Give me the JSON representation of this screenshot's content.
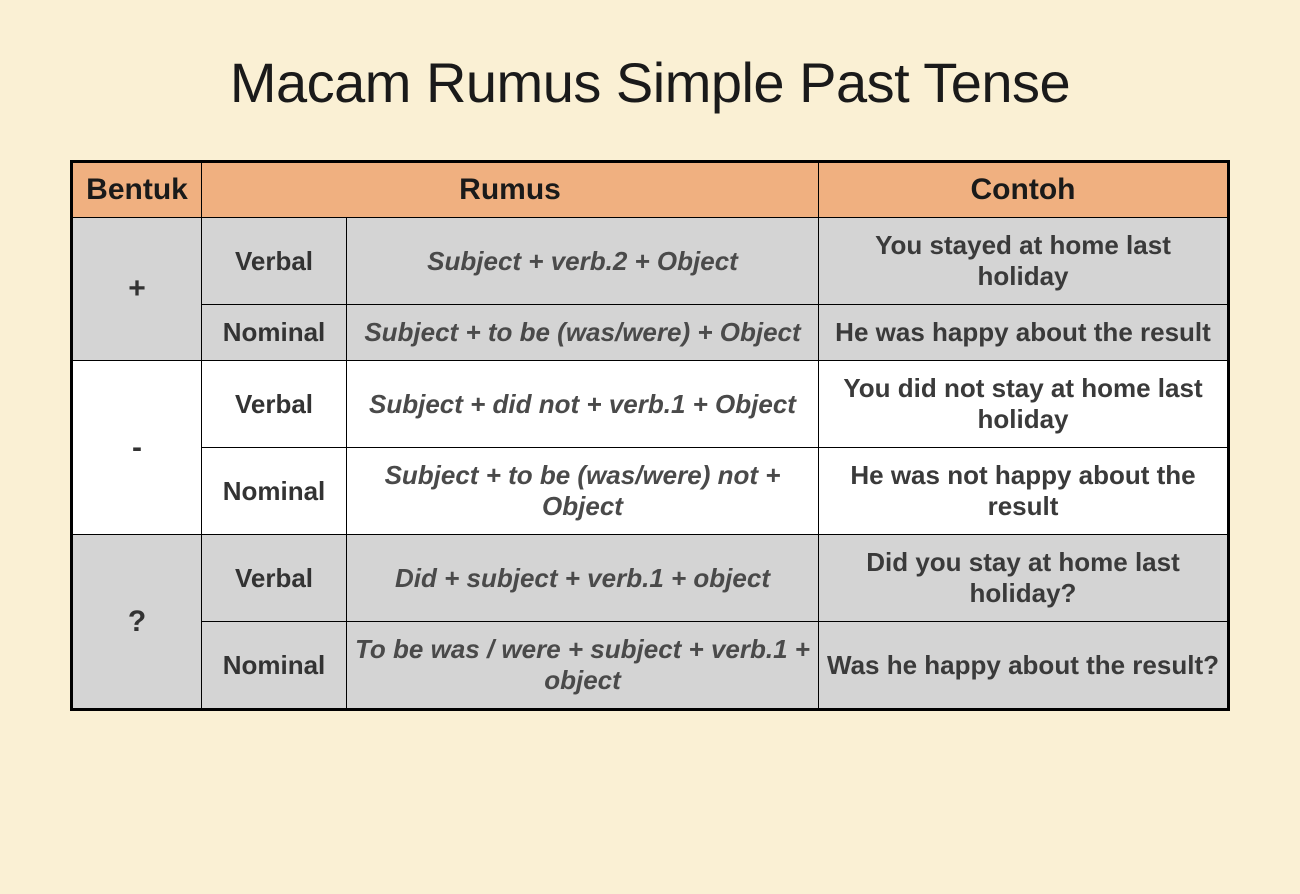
{
  "title": "Macam Rumus Simple Past Tense",
  "headers": {
    "bentuk": "Bentuk",
    "rumus": "Rumus",
    "contoh": "Contoh"
  },
  "rows": [
    {
      "bentuk": "+",
      "type": "Verbal",
      "rumus": "Subject + verb.2 + Object",
      "contoh": "You stayed at home last holiday"
    },
    {
      "bentuk": "",
      "type": "Nominal",
      "rumus": "Subject + to be (was/were) + Object",
      "contoh": "He was happy about the result"
    },
    {
      "bentuk": "-",
      "type": "Verbal",
      "rumus": "Subject + did not + verb.1 + Object",
      "contoh": "You did not stay at home last holiday"
    },
    {
      "bentuk": "",
      "type": "Nominal",
      "rumus": "Subject + to be (was/were) not + Object",
      "contoh": "He was not happy about the result"
    },
    {
      "bentuk": "?",
      "type": "Verbal",
      "rumus": "Did + subject + verb.1 + object",
      "contoh": "Did you stay at home last holiday?"
    },
    {
      "bentuk": "",
      "type": "Nominal",
      "rumus": "To be was / were + subject + verb.1 + object",
      "contoh": "Was he happy about the result?"
    }
  ]
}
